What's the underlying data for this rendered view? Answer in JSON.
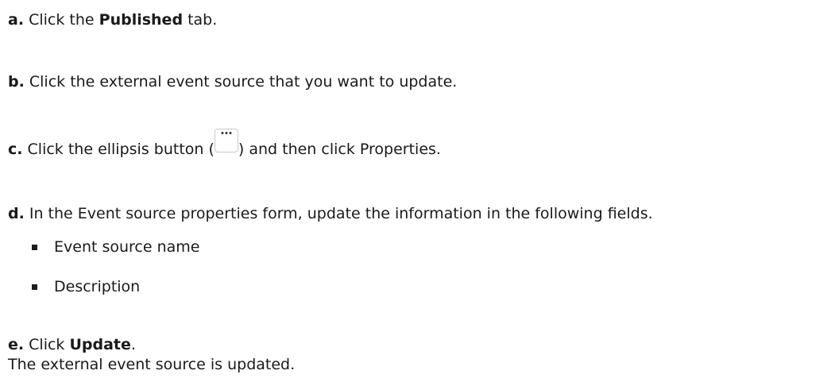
{
  "steps": {
    "a": {
      "letter": "a.",
      "pre": "Click the ",
      "bold": "Published",
      "post": " tab."
    },
    "b": {
      "letter": "b.",
      "text": "Click the external event source that you want to update."
    },
    "c": {
      "letter": "c.",
      "pre": "Click the ellipsis button (",
      "post": ") and then click Properties.",
      "button_icon": "ellipsis-icon"
    },
    "d": {
      "letter": "d.",
      "text": "In the Event source properties form, update the information in the following fields.",
      "bullets": [
        "Event source name",
        "Description"
      ]
    },
    "e": {
      "letter": "e.",
      "pre": "Click ",
      "bold": "Update",
      "post": ".",
      "result": "The external event source is updated."
    }
  }
}
